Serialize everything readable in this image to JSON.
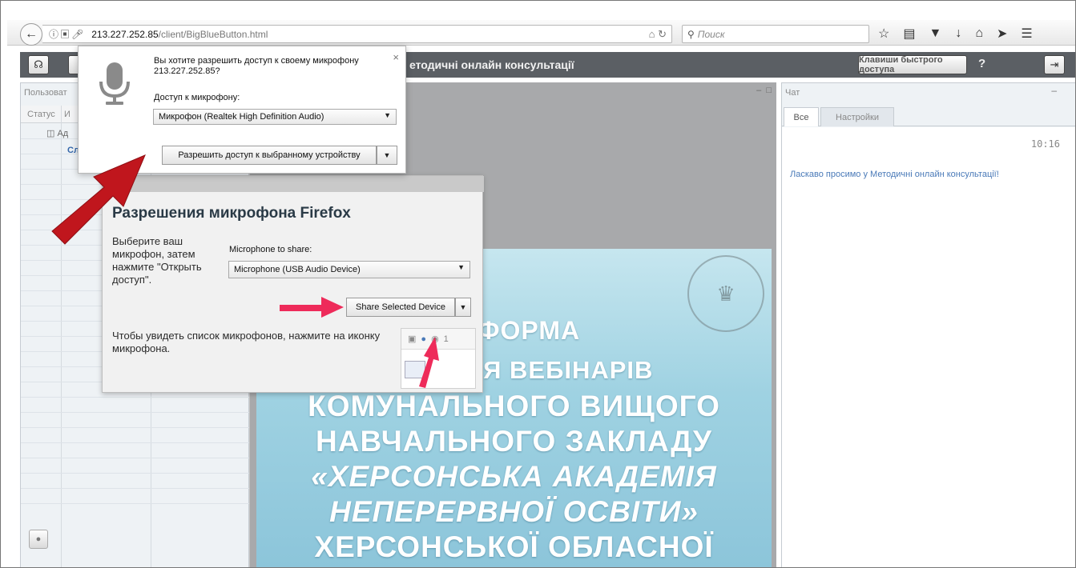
{
  "browser": {
    "url_host": "213.227.252.85",
    "url_path": "/client/BigBlueButton.html",
    "search_placeholder": "Поиск"
  },
  "bbb": {
    "title": "етодичні онлайн консультації",
    "shortcut_label": "Клавиши быстрого доступа",
    "help_label": "?"
  },
  "users": {
    "title": "Пользоват",
    "col_status": "Статус",
    "col_name": "И",
    "user1": "Ад",
    "user2": "Сл"
  },
  "chat": {
    "title": "Чат",
    "tab_all": "Все",
    "tab_settings": "Настройки",
    "time": "10:16",
    "welcome": "Ласкаво просимо у Методичні онлайн консультації!"
  },
  "slide": {
    "lines": [
      "ТФОРМА",
      "ДЕННЯ ВЕБІНАРІВ",
      "КОМУНАЛЬНОГО ВИЩОГО",
      "НАВЧАЛЬНОГО ЗАКЛАДУ",
      "«ХЕРСОНСЬКА АКАДЕМІЯ",
      "НЕПЕРЕРВНОЇ ОСВІТИ»",
      "ХЕРСОНСЬКОЇ ОБЛАСНОЇ"
    ]
  },
  "doorhanger": {
    "question": "Вы хотите разрешить доступ к своему микрофону 213.227.252.85?",
    "label": "Доступ к микрофону:",
    "selected_device": "Микрофон (Realtek High Definition Audio)",
    "allow_button": "Разрешить доступ к выбранному устройству",
    "close": "×"
  },
  "help_dialog": {
    "heading": "Разрешения микрофона Firefox",
    "instruction": "Выберите ваш микрофон, затем нажмите \"Открыть доступ\".",
    "share_label": "Microphone to share:",
    "selected_device": "Microphone (USB Audio Device)",
    "share_button": "Share Selected Device",
    "hint": "Чтобы увидеть список микрофонов, нажмите на иконку микрофона.",
    "thumb_digit": "1"
  },
  "colors": {
    "annotation_red": "#c0161d",
    "annotation_pink": "#ee2b5a"
  }
}
